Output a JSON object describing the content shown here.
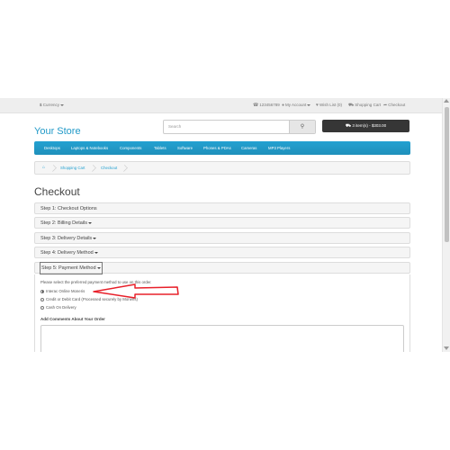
{
  "topbar": {
    "currency": "Currency",
    "phone": "123456789",
    "my_account": "My Account",
    "wishlist": "Wish List (0)",
    "shopping_cart": "Shopping Cart",
    "checkout": "Checkout"
  },
  "header": {
    "logo": "Your Store",
    "search_placeholder": "Search",
    "cart_button": "3 item(s) - $303.00"
  },
  "menu": [
    "Desktops",
    "Laptops & Notebooks",
    "Components",
    "Tablets",
    "Software",
    "Phones & PDAs",
    "Cameras",
    "MP3 Players"
  ],
  "breadcrumb": [
    "Shopping Cart",
    "Checkout"
  ],
  "page_title": "Checkout",
  "steps": [
    "Step 1: Checkout Options",
    "Step 2: Billing Details",
    "Step 3: Delivery Details",
    "Step 4: Delivery Method",
    "Step 5: Payment Method"
  ],
  "payment": {
    "intro": "Please select the preferred payment method to use on this order.",
    "options": [
      {
        "label": "Interac Online Moneris",
        "selected": true
      },
      {
        "label": "Credit or Debit Card (Processed securely by Moneris)",
        "selected": false
      },
      {
        "label": "Cash On Delivery",
        "selected": false
      }
    ],
    "comments_label": "Add Comments About Your Order"
  },
  "colors": {
    "accent": "#229ac8",
    "annotation_arrow": "#e8202a",
    "cart_button_bg": "#363636"
  },
  "icons": {
    "home": "home-icon",
    "search": "search-icon",
    "cart": "cart-icon",
    "phone": "phone-icon",
    "user": "user-icon",
    "heart": "heart-icon",
    "share": "share-icon"
  }
}
